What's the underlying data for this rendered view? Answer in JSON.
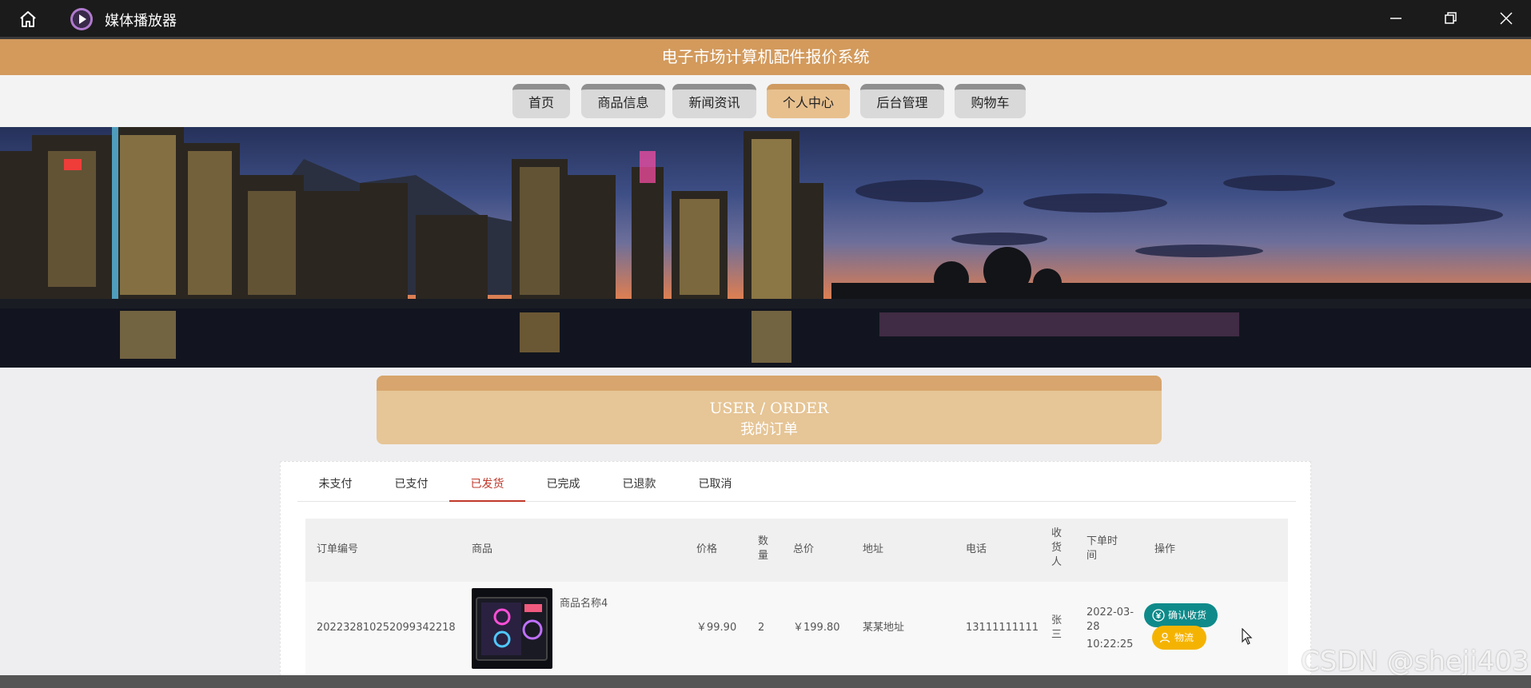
{
  "player": {
    "title": "媒体播放器"
  },
  "site": {
    "title": "电子市场计算机配件报价系统"
  },
  "nav": {
    "items": [
      {
        "label": "首页"
      },
      {
        "label": "商品信息"
      },
      {
        "label": "新闻资讯"
      },
      {
        "label": "个人中心",
        "active": true
      },
      {
        "label": "后台管理"
      },
      {
        "label": "购物车"
      }
    ]
  },
  "order_header": {
    "en": "USER / ORDER",
    "cn": "我的订单"
  },
  "tabs": [
    {
      "label": "未支付"
    },
    {
      "label": "已支付"
    },
    {
      "label": "已发货",
      "active": true
    },
    {
      "label": "已完成"
    },
    {
      "label": "已退款"
    },
    {
      "label": "已取消"
    }
  ],
  "table": {
    "columns": [
      "订单编号",
      "商品",
      "价格",
      "数量",
      "总价",
      "地址",
      "电话",
      "收货人",
      "下单时间",
      "操作"
    ],
    "rows": [
      {
        "order_no": "202232810252099342218",
        "product_name": "商品名称4",
        "price": "￥99.90",
        "quantity": "2",
        "total": "￥199.80",
        "address": "某某地址",
        "phone": "13111111111",
        "receiver": "张三",
        "order_date": "2022-03-28",
        "order_time": "10:22:25",
        "actions": {
          "confirm": "确认收货",
          "logistics": "物流"
        }
      }
    ]
  },
  "watermark": "CSDN @sheji403",
  "colors": {
    "header": "#d39a5c",
    "nav_active": "#e8c08e",
    "tab_active": "#c0392b",
    "confirm": "#0f8a8a",
    "logistics": "#f5b301"
  }
}
